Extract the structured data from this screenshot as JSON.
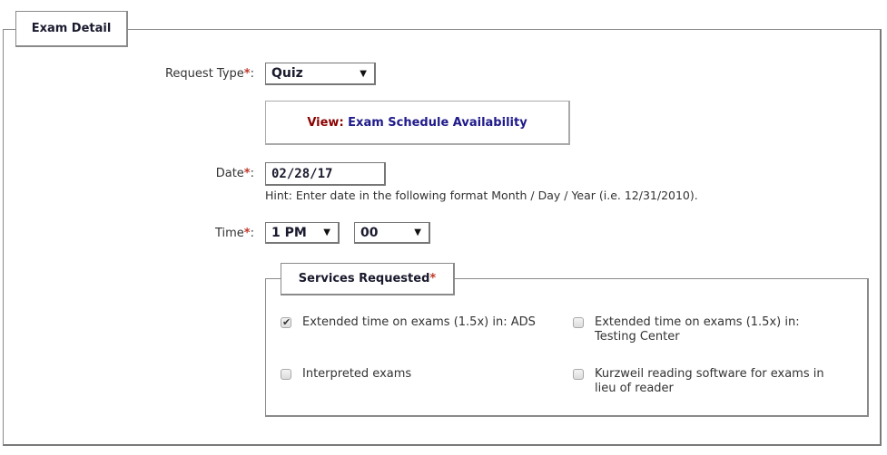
{
  "section": {
    "legend": "Exam Detail"
  },
  "request_type": {
    "label": "Request Type",
    "required_mark": "*",
    "colon": ":",
    "value": "Quiz"
  },
  "view": {
    "prefix": "View",
    "separator": ": ",
    "link_text": "Exam Schedule Availability"
  },
  "date": {
    "label": "Date",
    "required_mark": "*",
    "colon": ":",
    "value": "02/28/17",
    "hint": "Hint: Enter date in the following format Month / Day / Year (i.e. 12/31/2010)."
  },
  "time": {
    "label": "Time",
    "required_mark": "*",
    "colon": ":",
    "hour_value": "1 PM",
    "minute_value": "00"
  },
  "services": {
    "legend": "Services Requested",
    "required_mark": "*",
    "options": [
      {
        "label": "Extended time on exams (1.5x) in: ADS",
        "checked": true
      },
      {
        "label": "Extended time on exams (1.5x) in: Testing Center",
        "checked": false
      },
      {
        "label": "Interpreted exams",
        "checked": false
      },
      {
        "label": "Kurzweil reading software for exams in lieu of reader",
        "checked": false
      }
    ]
  },
  "icons": {
    "dropdown_arrow": "▼"
  },
  "colors": {
    "required": "#c0392b",
    "link": "#1f1a8a",
    "view_prefix": "#8b0000",
    "border": "#8a8a8a"
  }
}
